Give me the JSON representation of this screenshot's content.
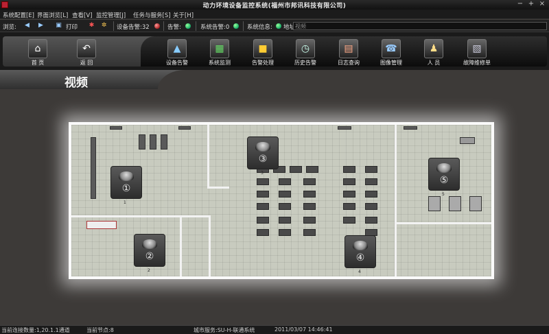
{
  "window": {
    "title": "动力环境设备监控系统(福州市邦讯科技有限公司)",
    "controls": [
      "−",
      "+",
      "×"
    ]
  },
  "menu": {
    "items": [
      "系统配置[E]",
      "界面浏览[L]",
      "查看[V]",
      "监控管理[J]",
      "任务与服务[S]",
      "关于[H]"
    ]
  },
  "toolbar": {
    "nav_label": "浏览:",
    "print_label": "打印",
    "device_alarm": "设备告警:32",
    "alarm_label": "告警:",
    "lost_label": "系统告警:0",
    "sys_info": "系统信息:",
    "address_label": "地址:",
    "address_value": "视频"
  },
  "nav_home": {
    "icon": "home-icon",
    "label": "首 页"
  },
  "nav_back": {
    "icon": "back-arrow-icon",
    "label": "返 回"
  },
  "nav_buttons": [
    {
      "icon": "warning-icon",
      "label": "设备告警"
    },
    {
      "icon": "monitor-icon",
      "label": "系统监测"
    },
    {
      "icon": "folder-icon",
      "label": "告警处理"
    },
    {
      "icon": "clock-icon",
      "label": "历史告警"
    },
    {
      "icon": "chart-icon",
      "label": "日志查询"
    },
    {
      "icon": "phone-icon",
      "label": "图像管理"
    },
    {
      "icon": "user-icon",
      "label": "人 员"
    },
    {
      "icon": "document-icon",
      "label": "故障维修单"
    }
  ],
  "page": {
    "title": "视频"
  },
  "cameras": [
    {
      "num": "①",
      "id": "1"
    },
    {
      "num": "②",
      "id": "2"
    },
    {
      "num": "③",
      "id": "3"
    },
    {
      "num": "④",
      "id": "4"
    },
    {
      "num": "⑤",
      "id": "5"
    }
  ],
  "status": {
    "left": "当前连接数量:1,20.1.1通道",
    "mid1": "当前节点:8",
    "mid2": "城市服务:SU-H-联通系统",
    "right": "2011/03/07 14:46:41"
  },
  "colors": {
    "accent": "#f3f3f3",
    "background": "#3d3a38",
    "ok": "#22aa66"
  }
}
